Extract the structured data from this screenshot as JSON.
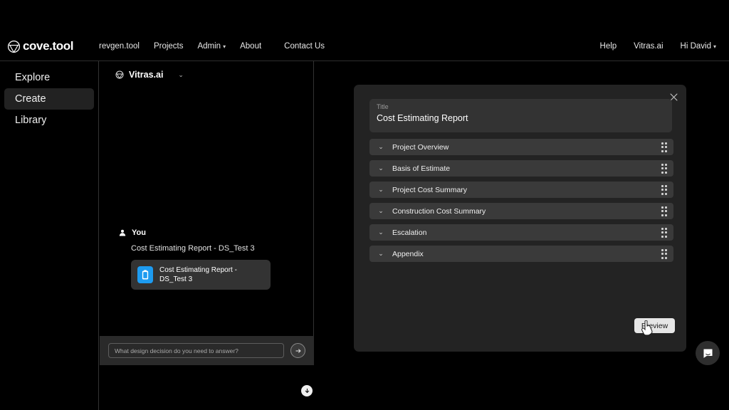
{
  "header": {
    "brand": "cove.tool",
    "brand_icon": "cove-logo-icon",
    "nav_left": [
      {
        "label": "revgen.tool",
        "has_caret": false
      },
      {
        "label": "Projects",
        "has_caret": false
      },
      {
        "label": "Admin",
        "has_caret": true
      },
      {
        "label": "About",
        "has_caret": false
      },
      {
        "label": "Contact Us",
        "has_caret": false
      }
    ],
    "nav_right": [
      {
        "label": "Help",
        "has_caret": false
      },
      {
        "label": "Vitras.ai",
        "has_caret": false
      },
      {
        "label": "Hi David",
        "has_caret": true
      }
    ],
    "caret_glyph": "▾"
  },
  "sidebar": {
    "items": [
      {
        "label": "Explore",
        "active": false
      },
      {
        "label": "Create",
        "active": true
      },
      {
        "label": "Library",
        "active": false
      }
    ]
  },
  "chat": {
    "title": "Vitras.ai",
    "title_icon": "vitras-logo-icon",
    "dropdown_glyph": "⌄",
    "message": {
      "author": "You",
      "author_icon": "user-avatar-icon",
      "text": "Cost Estimating Report - DS_Test 3",
      "attachment": {
        "name": "Cost Estimating Report - DS_Test 3",
        "icon": "document-icon",
        "icon_color": "#1d9bf0"
      }
    },
    "scroll_to_bottom_icon": "arrow-down-circle-icon",
    "input": {
      "value": "",
      "placeholder": "What design decision do you need to answer?"
    },
    "send_icon": "arrow-right-icon"
  },
  "modal": {
    "close_icon": "close-icon",
    "title_label": "Title",
    "title_value": "Cost Estimating Report",
    "sections": [
      {
        "label": "Project Overview"
      },
      {
        "label": "Basis of Estimate"
      },
      {
        "label": "Project Cost Summary"
      },
      {
        "label": "Construction Cost Summary"
      },
      {
        "label": "Escalation"
      },
      {
        "label": "Appendix"
      }
    ],
    "section_caret_glyph": "⌄",
    "drag_handle_icon": "drag-handle-icon",
    "preview_label": "Preview"
  },
  "launcher": {
    "icon": "chat-bubble-icon"
  },
  "cursor": {
    "icon": "pointer-hand-cursor"
  },
  "colors": {
    "page_background": "#000000",
    "modal_background": "#232323",
    "section_row": "#3a3a3a",
    "accent_blue": "#1d9bf0",
    "preview_button": "#e6e6e6"
  }
}
